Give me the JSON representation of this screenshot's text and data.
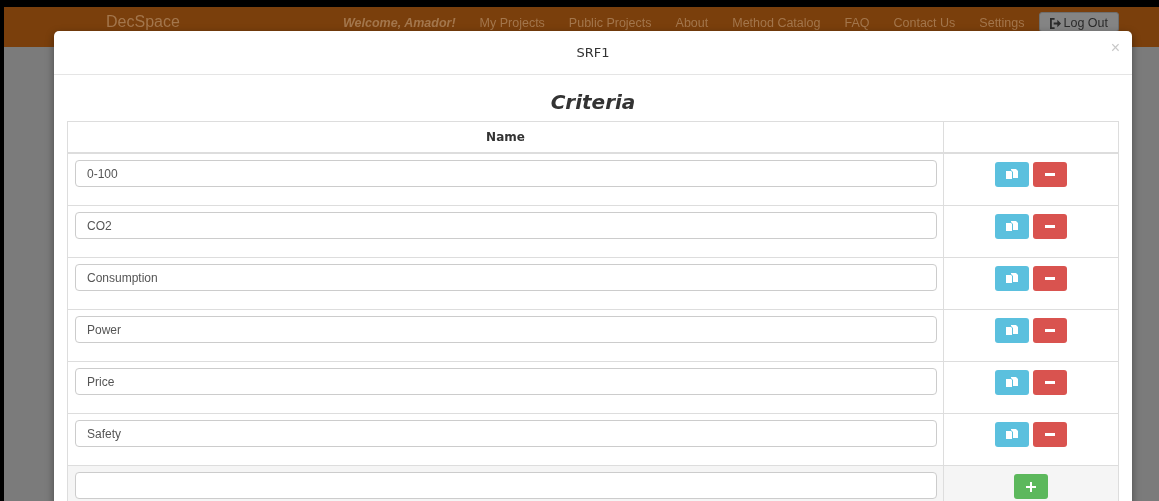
{
  "navbar": {
    "brand": "DecSpace",
    "welcome": "Welcome, Amador!",
    "links": [
      "My Projects",
      "Public Projects",
      "About",
      "Method Catalog",
      "FAQ",
      "Contact Us",
      "Settings"
    ],
    "logout": "Log Out"
  },
  "modal": {
    "title": "SRF1",
    "close": "×",
    "heading": "Criteria",
    "columns": [
      "Name"
    ],
    "rows": [
      {
        "value": "0-100"
      },
      {
        "value": "CO2"
      },
      {
        "value": "Consumption"
      },
      {
        "value": "Power"
      },
      {
        "value": "Price"
      },
      {
        "value": "Safety"
      }
    ]
  }
}
